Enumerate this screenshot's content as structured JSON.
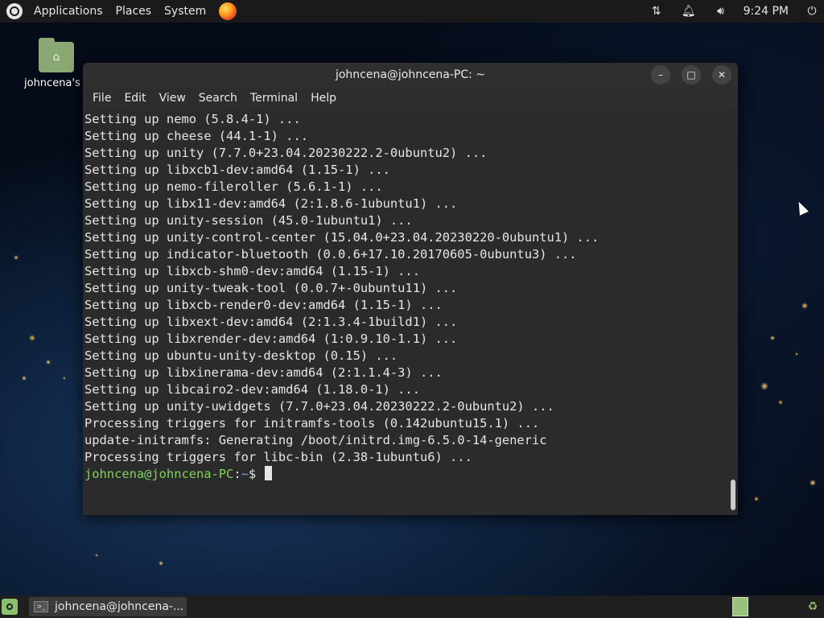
{
  "top_panel": {
    "menus": [
      "Applications",
      "Places",
      "System"
    ],
    "clock": "9:24 PM"
  },
  "desktop": {
    "home_icon_label": "johncena's Home"
  },
  "terminal": {
    "title": "johncena@johncena-PC: ~",
    "menu": [
      "File",
      "Edit",
      "View",
      "Search",
      "Terminal",
      "Help"
    ],
    "lines": [
      "Setting up nemo (5.8.4-1) ...",
      "Setting up cheese (44.1-1) ...",
      "Setting up unity (7.7.0+23.04.20230222.2-0ubuntu2) ...",
      "Setting up libxcb1-dev:amd64 (1.15-1) ...",
      "Setting up nemo-fileroller (5.6.1-1) ...",
      "Setting up libx11-dev:amd64 (2:1.8.6-1ubuntu1) ...",
      "Setting up unity-session (45.0-1ubuntu1) ...",
      "Setting up unity-control-center (15.04.0+23.04.20230220-0ubuntu1) ...",
      "Setting up indicator-bluetooth (0.0.6+17.10.20170605-0ubuntu3) ...",
      "Setting up libxcb-shm0-dev:amd64 (1.15-1) ...",
      "Setting up unity-tweak-tool (0.0.7+-0ubuntu11) ...",
      "Setting up libxcb-render0-dev:amd64 (1.15-1) ...",
      "Setting up libxext-dev:amd64 (2:1.3.4-1build1) ...",
      "Setting up libxrender-dev:amd64 (1:0.9.10-1.1) ...",
      "Setting up ubuntu-unity-desktop (0.15) ...",
      "Setting up libxinerama-dev:amd64 (2:1.1.4-3) ...",
      "Setting up libcairo2-dev:amd64 (1.18.0-1) ...",
      "Setting up unity-uwidgets (7.7.0+23.04.20230222.2-0ubuntu2) ...",
      "Processing triggers for initramfs-tools (0.142ubuntu15.1) ...",
      "update-initramfs: Generating /boot/initrd.img-6.5.0-14-generic",
      "Processing triggers for libc-bin (2.38-1ubuntu6) ..."
    ],
    "prompt_user": "johncena@johncena-PC",
    "prompt_path": "~",
    "prompt_symbol": "$"
  },
  "taskbar": {
    "task_label": "johncena@johncena-..."
  },
  "colors": {
    "prompt_user": "#7fd35a",
    "prompt_path": "#7aa7e6",
    "accent": "#8ac06e"
  }
}
